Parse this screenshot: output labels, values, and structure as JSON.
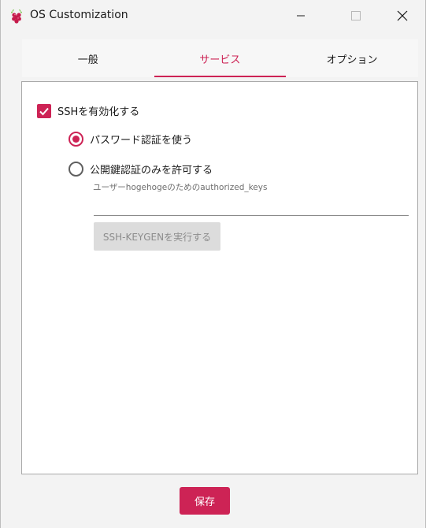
{
  "window": {
    "title": "OS Customization"
  },
  "tabs": [
    {
      "label": "一般",
      "active": false
    },
    {
      "label": "サービス",
      "active": true
    },
    {
      "label": "オプション",
      "active": false
    }
  ],
  "services": {
    "ssh_enable_label": "SSHを有効化する",
    "ssh_enabled": true,
    "auth_options": [
      {
        "label": "パスワード認証を使う",
        "selected": true
      },
      {
        "label": "公開鍵認証のみを許可する",
        "selected": false
      }
    ],
    "authorized_keys_hint": "ユーザーhogehogeのためのauthorized_keys",
    "authorized_keys_value": "",
    "keygen_button_label": "SSH-KEYGENを実行する"
  },
  "footer": {
    "save_label": "保存"
  },
  "colors": {
    "accent": "#cd2355",
    "disabled_button_bg": "#dcdcdc",
    "disabled_button_text": "#8c8c8c"
  }
}
